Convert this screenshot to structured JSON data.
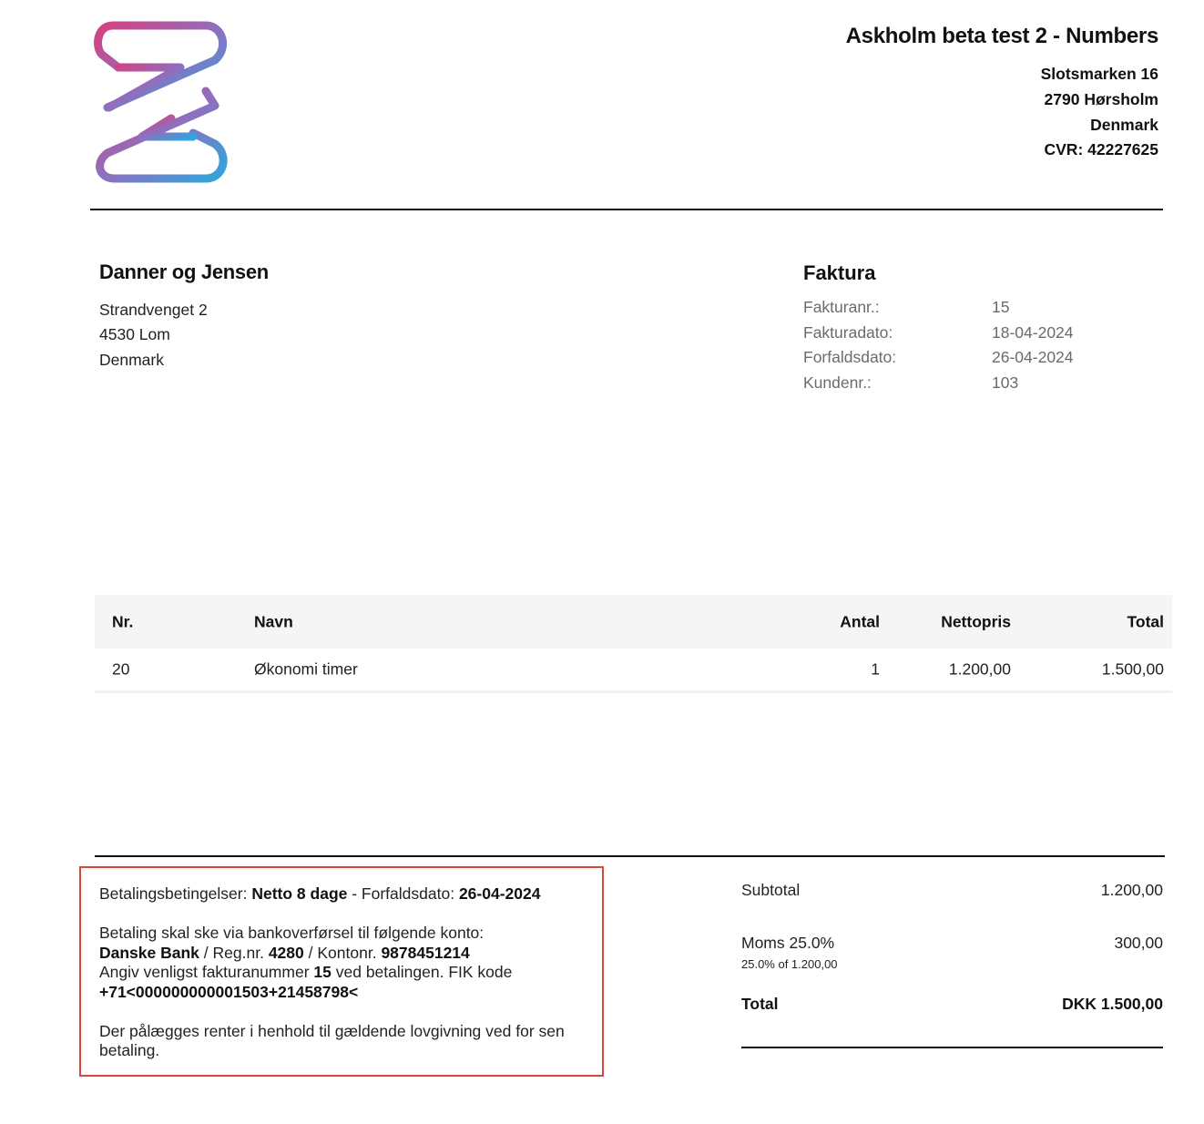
{
  "company": {
    "name": "Askholm beta test 2 - Numbers",
    "address": [
      "Slotsmarken 16",
      "2790 Hørsholm",
      "Denmark",
      "CVR: 42227625"
    ]
  },
  "customer": {
    "name": "Danner og Jensen",
    "address": [
      "Strandvenget 2",
      "4530 Lom",
      "Denmark"
    ]
  },
  "invoice": {
    "title": "Faktura",
    "meta": [
      {
        "label": "Fakturanr.:",
        "value": "15"
      },
      {
        "label": "Fakturadato:",
        "value": "18-04-2024"
      },
      {
        "label": "Forfaldsdato:",
        "value": "26-04-2024"
      },
      {
        "label": "Kundenr.:",
        "value": "103"
      }
    ]
  },
  "table": {
    "headers": {
      "nr": "Nr.",
      "navn": "Navn",
      "antal": "Antal",
      "nettopris": "Nettopris",
      "total": "Total"
    },
    "rows": [
      {
        "nr": "20",
        "navn": "Økonomi timer",
        "antal": "1",
        "nettopris": "1.200,00",
        "total": "1.500,00"
      }
    ]
  },
  "payment": {
    "terms_label": "Betalingsbetingelser:",
    "terms_value": "Netto 8 dage",
    "due_sep": " - Forfaldsdato:",
    "due_value": "26-04-2024",
    "transfer_text": "Betaling skal ske via bankoverførsel til følgende konto:",
    "bank": "Danske Bank",
    "reg_label": "/ Reg.nr.",
    "reg_value": "4280",
    "konto_label": "/ Kontonr.",
    "konto_value": "9878451214",
    "ref_text_1": "Angiv venligst fakturanummer",
    "ref_invoice": "15",
    "ref_text_2": "ved betalingen. FIK kode",
    "fik_code": "+71<000000000001503+21458798<",
    "interest_text": "Der pålægges renter i henhold til gældende lovgivning ved for sen betaling."
  },
  "totals": {
    "subtotal_label": "Subtotal",
    "subtotal_value": "1.200,00",
    "vat_label": "Moms 25.0%",
    "vat_value": "300,00",
    "vat_note": "25.0% of 1.200,00",
    "total_label": "Total",
    "total_value": "DKK 1.500,00"
  },
  "colors": {
    "logo_gradient_start": "#d6407f",
    "logo_gradient_end": "#2ea6dc",
    "payment_box_border": "#d9453a"
  }
}
